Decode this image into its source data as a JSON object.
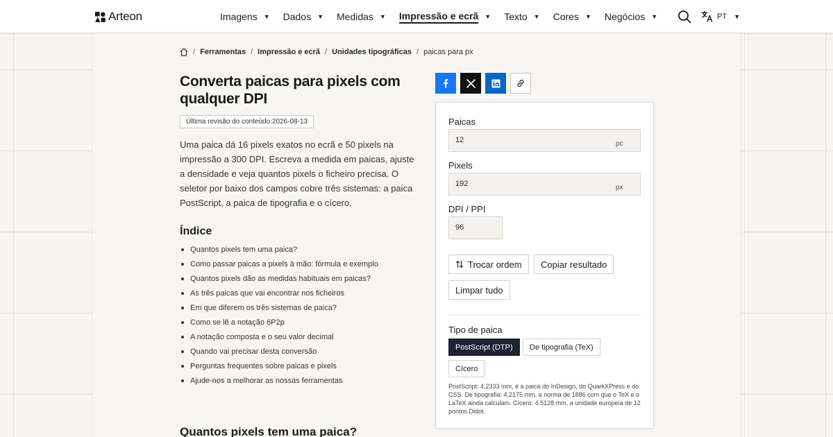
{
  "header": {
    "logo_text": "Arteon",
    "nav": [
      {
        "label": "Imagens",
        "active": false
      },
      {
        "label": "Dados",
        "active": false
      },
      {
        "label": "Medidas",
        "active": false
      },
      {
        "label": "Impressão e ecrã",
        "active": true
      },
      {
        "label": "Texto",
        "active": false
      },
      {
        "label": "Cores",
        "active": false
      },
      {
        "label": "Negócios",
        "active": false
      }
    ],
    "lang": "PT"
  },
  "breadcrumb": {
    "items": [
      "Ferramentas",
      "Impressão e ecrã",
      "Unidades tipográficas"
    ],
    "current": "paicas para px"
  },
  "article": {
    "title": "Converta paicas para pixels com qualquer DPI",
    "revision_label": "Última revisão do conteúdo:",
    "revision_date": "2026-08-13",
    "intro": "Uma paica dá 16 pixels exatos no ecrã e 50 pixels na impressão a 300 DPI. Escreva a medida em paicas, ajuste a densidade e veja quantos pixels o ficheiro precisa. O seletor por baixo dos campos cobre três sistemas: a paica PostScript, a paica de tipografia e o cícero.",
    "toc_title": "Índice",
    "toc": [
      "Quantos pixels tem uma paica?",
      "Como passar paicas a pixels à mão: fórmula e exemplo",
      "Quantos pixels dão as medidas habituais em paicas?",
      "As três paicas que vai encontrar nos ficheiros",
      "Em que diferem os três sistemas de paica?",
      "Como se lê a notação 6P2p",
      "A notação composta e o seu valor decimal",
      "Quando vai precisar desta conversão",
      "Perguntas frequentes sobre paicas e pixels",
      "Ajude-nos a melhorar as nossas ferramentas"
    ],
    "section_title": "Quantos pixels tem uma paica?"
  },
  "converter": {
    "picas_label": "Paicas",
    "picas_value": "12",
    "picas_unit": "pc",
    "pixels_label": "Pixels",
    "pixels_value": "192",
    "pixels_unit": "px",
    "dpi_label": "DPI / PPI",
    "dpi_value": "96",
    "swap_label": "Trocar ordem",
    "copy_label": "Copiar resultado",
    "clear_label": "Limpar tudo",
    "type_label": "Tipo de paica",
    "options": [
      {
        "label": "PostScript (DTP)",
        "selected": true
      },
      {
        "label": "De tipografia (TeX)",
        "selected": false
      },
      {
        "label": "Cícero",
        "selected": false
      }
    ],
    "note": "PostScript: 4,2333 mm, é a paica do InDesign, do QuarkXPress e do CSS. De tipografia: 4,2175 mm, a norma de 1886 com que o TeX e o LaTeX ainda calculam. Cícero: 4,5128 mm, a unidade europeia de 12 pontos Didot."
  },
  "colors": {
    "facebook": "#1877f2",
    "x": "#111111",
    "linkedin": "#0a66c2",
    "selected_option": "#1c2333"
  }
}
